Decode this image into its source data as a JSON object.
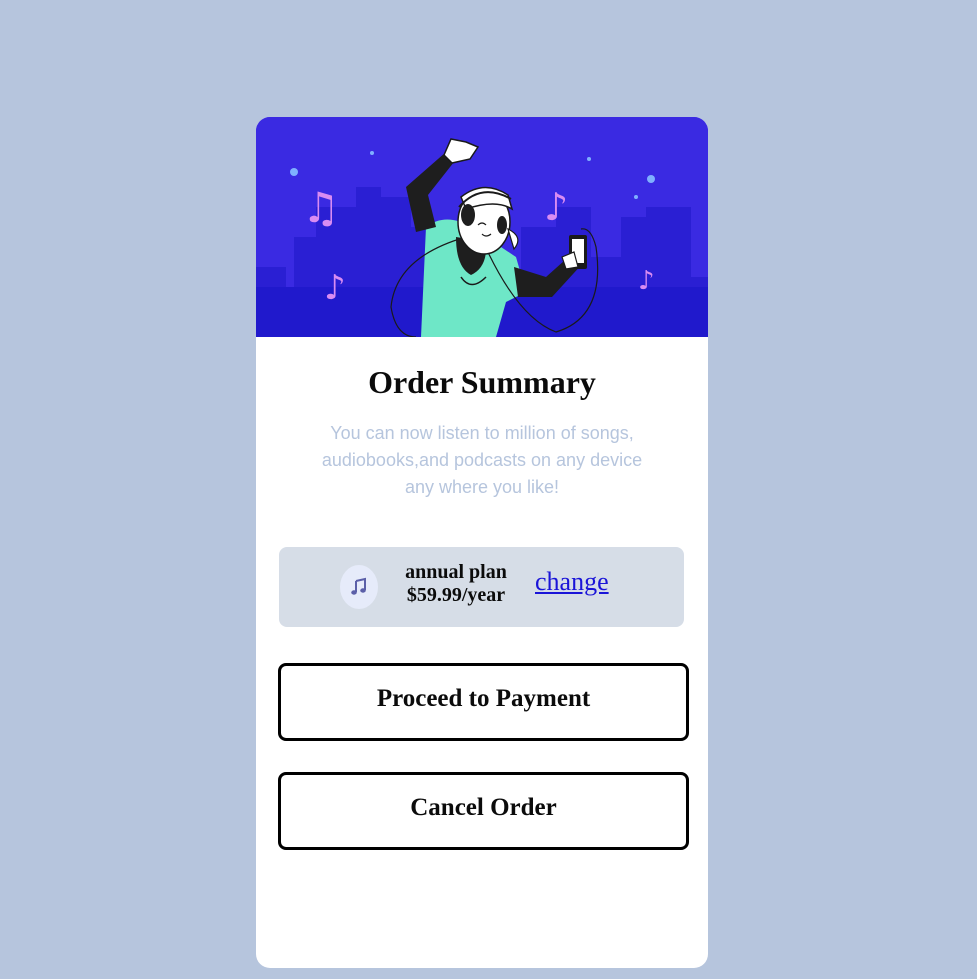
{
  "card": {
    "title": "Order Summary",
    "description": "You can now listen to million of songs, audiobooks,and podcasts on any device any where you like!"
  },
  "plan": {
    "icon": "music-note-icon",
    "name": "annual plan",
    "price": "$59.99/year",
    "change_label": "change"
  },
  "actions": {
    "proceed_label": "Proceed to Payment",
    "cancel_label": "Cancel Order"
  },
  "colors": {
    "page_background": "#b6c5dd",
    "hero_background": "#3b2be4",
    "card_background": "#ffffff",
    "plan_background": "#d6dde7",
    "link": "#1a14d8",
    "description_text": "#b6c5dd"
  }
}
